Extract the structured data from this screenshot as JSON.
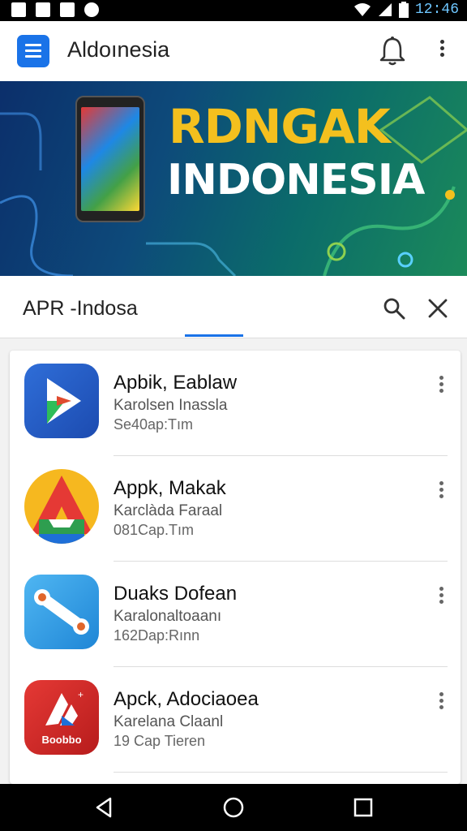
{
  "status_bar": {
    "time": "12:46",
    "left_icons": [
      "image-icon",
      "lock-icon",
      "a-icon",
      "clock-icon"
    ],
    "right_icons": [
      "wifi-icon",
      "signal-icon",
      "battery-icon"
    ]
  },
  "app_bar": {
    "title": "Aldoınesia",
    "icons": [
      "menu-icon",
      "bell-icon",
      "more-vert-icon"
    ],
    "accent": "#1a73e8"
  },
  "banner": {
    "line1": "RDNGAK",
    "line2": "INDONESIA",
    "line1_color": "#f4c01e"
  },
  "search": {
    "query": "APR -Indosa",
    "icons": [
      "search-icon",
      "close-icon"
    ]
  },
  "apps": [
    {
      "title": "Apbik, Eablaw",
      "subtitle": "Karolsen Inassla",
      "meta": "Se40ap:Tım",
      "icon": "blue-play-app-icon"
    },
    {
      "title": "Appk, Makak",
      "subtitle": "Karclàda Faraal",
      "meta": "081Cap.Tım",
      "icon": "yellow-red-a-app-icon"
    },
    {
      "title": "Duaks Dofean",
      "subtitle": "Karalonaltoaanı",
      "meta": "162Dap:Rınn",
      "icon": "light-blue-tool-app-icon"
    },
    {
      "title": "Apck, Adociaoea",
      "subtitle": "Karelana Claanl",
      "meta": "19 Cap Tieren",
      "icon": "red-bookbo-app-icon",
      "icon_text": "Boobbo"
    }
  ],
  "nav_bar": {
    "icons": [
      "back-icon",
      "home-icon",
      "recents-icon"
    ]
  }
}
